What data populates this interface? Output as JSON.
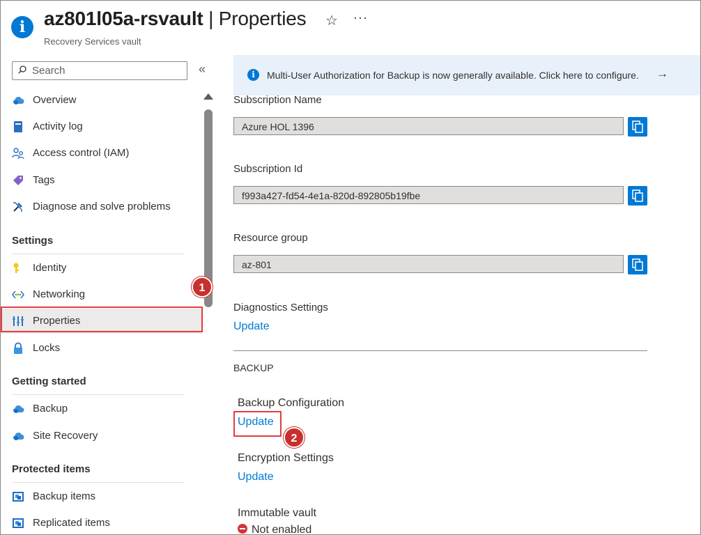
{
  "header": {
    "title": "az801l05a-rsvault",
    "separator": "|",
    "page": "Properties",
    "subtitle": "Recovery Services vault",
    "star_icon": "star-icon",
    "more_icon": "more-icon"
  },
  "sidebar": {
    "search_placeholder": "Search",
    "collapse_label": "«",
    "top_items": [
      {
        "label": "Overview",
        "icon": "overview-cloud-icon"
      },
      {
        "label": "Activity log",
        "icon": "activity-log-icon"
      },
      {
        "label": "Access control (IAM)",
        "icon": "access-control-icon"
      },
      {
        "label": "Tags",
        "icon": "tag-icon"
      },
      {
        "label": "Diagnose and solve problems",
        "icon": "wrench-icon"
      }
    ],
    "settings": {
      "heading": "Settings",
      "items": [
        {
          "label": "Identity",
          "icon": "identity-key-icon"
        },
        {
          "label": "Networking",
          "icon": "networking-icon"
        },
        {
          "label": "Properties",
          "icon": "properties-icon",
          "selected": true
        },
        {
          "label": "Locks",
          "icon": "lock-icon"
        }
      ]
    },
    "getting_started": {
      "heading": "Getting started",
      "items": [
        {
          "label": "Backup",
          "icon": "backup-cloud-icon"
        },
        {
          "label": "Site Recovery",
          "icon": "site-recovery-icon"
        }
      ]
    },
    "protected_items": {
      "heading": "Protected items",
      "items": [
        {
          "label": "Backup items",
          "icon": "backup-items-icon"
        },
        {
          "label": "Replicated items",
          "icon": "replicated-items-icon"
        }
      ]
    }
  },
  "annotations": {
    "badge_1": "1",
    "badge_2": "2"
  },
  "banner": {
    "message": "Multi-User Authorization for Backup is now generally available. Click here to configure.",
    "arrow": "→"
  },
  "fields": {
    "subscription_name": {
      "label": "Subscription Name",
      "value": "Azure HOL 1396"
    },
    "subscription_id": {
      "label": "Subscription Id",
      "value": "f993a427-fd54-4e1a-820d-892805b19fbe"
    },
    "resource_group": {
      "label": "Resource group",
      "value": "az-801"
    }
  },
  "diagnostics": {
    "label": "Diagnostics Settings",
    "link": "Update"
  },
  "backup": {
    "section_label": "BACKUP",
    "configuration": {
      "label": "Backup Configuration",
      "link": "Update"
    },
    "encryption": {
      "label": "Encryption Settings",
      "link": "Update"
    },
    "immutable": {
      "label": "Immutable vault",
      "status": "Not enabled"
    }
  },
  "colors": {
    "accent": "#0078d4",
    "annotation_red": "#e8393f",
    "banner_bg": "#e8f1fa"
  }
}
